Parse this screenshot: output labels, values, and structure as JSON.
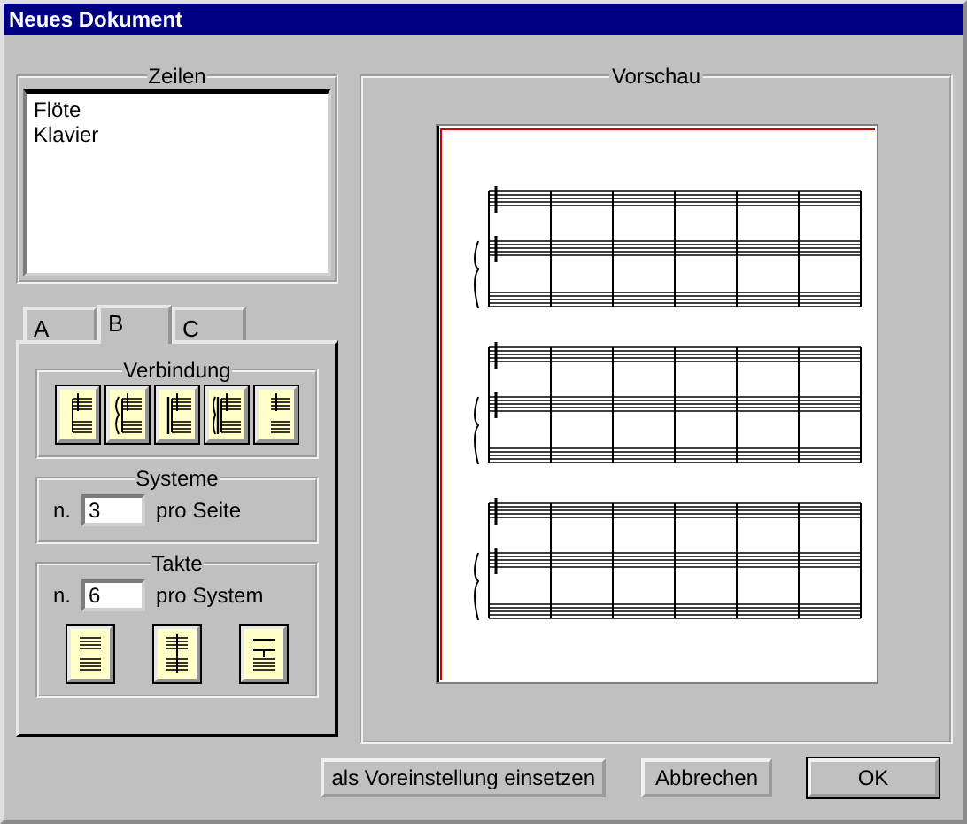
{
  "window": {
    "title": "Neues Dokument"
  },
  "lines_group": {
    "title": "Zeilen",
    "items": [
      {
        "label": "Flöte",
        "selected": false
      },
      {
        "label": "Klavier",
        "selected": false
      }
    ]
  },
  "tabs": [
    {
      "label": "A",
      "selected": false
    },
    {
      "label": "B",
      "selected": true
    },
    {
      "label": "C",
      "selected": false
    }
  ],
  "connection": {
    "title": "Verbindung",
    "options": [
      {
        "kind": "plain"
      },
      {
        "kind": "brace"
      },
      {
        "kind": "bracket"
      },
      {
        "kind": "bracket-brace"
      },
      {
        "kind": "single"
      }
    ]
  },
  "systems": {
    "title": "Systeme",
    "prefix": "n.",
    "value": "3",
    "suffix": "pro Seite"
  },
  "measures": {
    "title": "Takte",
    "prefix": "n.",
    "value": "6",
    "suffix": "pro System",
    "layouts": [
      {
        "kind": "split"
      },
      {
        "kind": "joined"
      },
      {
        "kind": "stem"
      }
    ]
  },
  "preview": {
    "title": "Vorschau"
  },
  "buttons": [
    {
      "label": "als Voreinstellung einsetzen",
      "default": false
    },
    {
      "label": "Abbrechen",
      "default": false
    },
    {
      "label": "OK",
      "default": true
    }
  ]
}
